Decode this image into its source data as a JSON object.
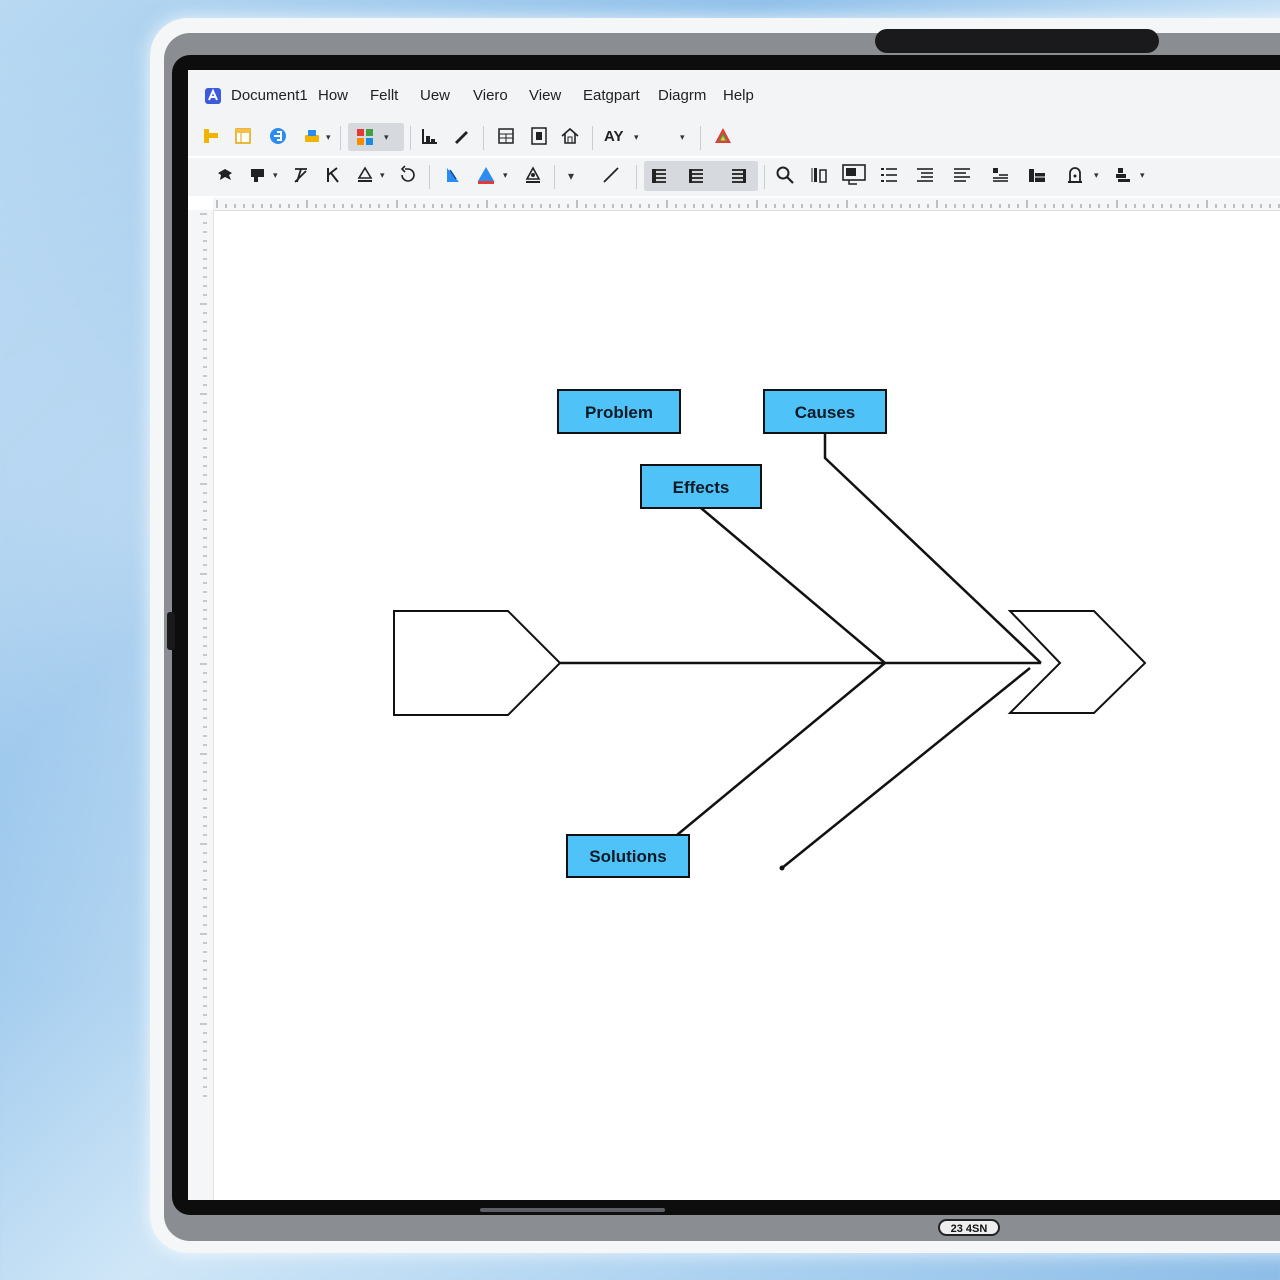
{
  "window": {
    "title": "Document1",
    "menu": [
      "How",
      "Fellt",
      "Uew",
      "Viero",
      "View",
      "Eatgpart",
      "Diagrm",
      "Help"
    ]
  },
  "toolbar": {
    "font_size_label": "AY",
    "icons_row1": [
      "open-folder-icon",
      "new-page-icon",
      "web-icon",
      "print-icon",
      "color-grid-icon",
      "chart-icon",
      "pen-icon",
      "layout-icon",
      "page-icon",
      "home-icon",
      "font-size-icon",
      "shapes-icon"
    ],
    "icons_row2": [
      "pin-icon",
      "fill-icon",
      "format-icon",
      "italic-k-icon",
      "shape-icon",
      "rotate-icon",
      "text-color-icon",
      "color-triangle-icon",
      "outline-icon",
      "line-icon",
      "align-left-icon",
      "align-center-icon",
      "align-right-icon",
      "search-icon",
      "column-icon",
      "textbox-icon",
      "list-icon",
      "indent-icon",
      "outdent-icon",
      "bullet-icon",
      "table-icon",
      "lock-icon",
      "arrange-icon"
    ]
  },
  "diagram": {
    "nodes": {
      "problem": "Problem",
      "causes": "Causes",
      "effects": "Effects",
      "solutions": "Solutions"
    },
    "box_fill": "#4fc3f7",
    "line_color": "#111111"
  },
  "device": {
    "badge": "23 4SN"
  }
}
